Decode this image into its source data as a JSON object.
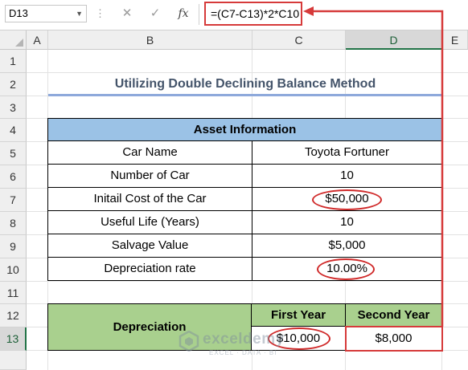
{
  "formula_bar": {
    "name_box": "D13",
    "cancel_icon": "✕",
    "enter_icon": "✓",
    "fx_label": "fx",
    "formula": "=(C7-C13)*2*C10"
  },
  "columns": [
    "A",
    "B",
    "C",
    "D",
    "E"
  ],
  "selected_column": "D",
  "rows": [
    "1",
    "2",
    "3",
    "4",
    "5",
    "6",
    "7",
    "8",
    "9",
    "10",
    "11",
    "12",
    "13"
  ],
  "selected_row": "13",
  "sheet": {
    "title": "Utilizing Double Declining Balance Method",
    "asset_table": {
      "header": "Asset Information",
      "rows": [
        {
          "label": "Car Name",
          "value": "Toyota Fortuner"
        },
        {
          "label": "Number of Car",
          "value": "10"
        },
        {
          "label": "Initail Cost of the Car",
          "value": "$50,000"
        },
        {
          "label": "Useful Life (Years)",
          "value": "10"
        },
        {
          "label": "Salvage Value",
          "value": "$5,000"
        },
        {
          "label": "Depreciation rate",
          "value": "10.00%"
        }
      ]
    },
    "depreciation_table": {
      "label": "Depreciation",
      "first_year_header": "First Year",
      "second_year_header": "Second Year",
      "first_year_value": "$10,000",
      "second_year_value": "$8,000"
    }
  },
  "watermark": {
    "name": "exceldemy",
    "tagline": "EXCEL · DATA · BI"
  },
  "colors": {
    "asset_header": "#9bc2e6",
    "depreciation_fill": "#a9d08e",
    "annotation_red": "#d02a2a",
    "title_text": "#44546a"
  }
}
